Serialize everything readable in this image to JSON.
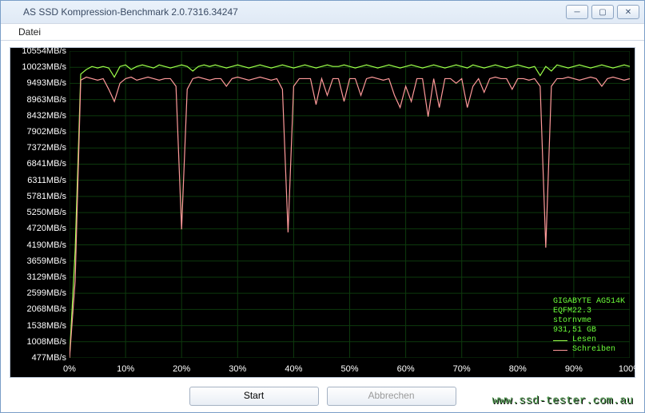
{
  "window": {
    "title": "AS SSD Kompression-Benchmark 2.0.7316.34247"
  },
  "menu": {
    "file": "Datei"
  },
  "legend": {
    "device": "GIGABYTE AG514K",
    "firmware": "EQFM22.3",
    "driver": "stornvme",
    "capacity": "931,51 GB",
    "read": "Lesen",
    "write": "Schreiben"
  },
  "buttons": {
    "start": "Start",
    "abort": "Abbrechen"
  },
  "watermark": "www.ssd-tester.com.au",
  "chart_data": {
    "type": "line",
    "xlabel": "",
    "ylabel": "",
    "xlim": [
      0,
      100
    ],
    "ylim": [
      477,
      10554
    ],
    "y_ticks": [
      477,
      1008,
      1538,
      2068,
      2599,
      3129,
      3659,
      4190,
      4720,
      5250,
      5781,
      6311,
      6841,
      7372,
      7902,
      8432,
      8963,
      9493,
      10023,
      10554
    ],
    "y_tick_suffix": "MB/s",
    "x_ticks": [
      0,
      10,
      20,
      30,
      40,
      50,
      60,
      70,
      80,
      90,
      100
    ],
    "x_tick_suffix": "%",
    "x": [
      0,
      1,
      2,
      3,
      4,
      5,
      6,
      7,
      8,
      9,
      10,
      11,
      12,
      13,
      14,
      15,
      16,
      17,
      18,
      19,
      20,
      21,
      22,
      23,
      24,
      25,
      26,
      27,
      28,
      29,
      30,
      31,
      32,
      33,
      34,
      35,
      36,
      37,
      38,
      39,
      40,
      41,
      42,
      43,
      44,
      45,
      46,
      47,
      48,
      49,
      50,
      51,
      52,
      53,
      54,
      55,
      56,
      57,
      58,
      59,
      60,
      61,
      62,
      63,
      64,
      65,
      66,
      67,
      68,
      69,
      70,
      71,
      72,
      73,
      74,
      75,
      76,
      77,
      78,
      79,
      80,
      81,
      82,
      83,
      84,
      85,
      86,
      87,
      88,
      89,
      90,
      91,
      92,
      93,
      94,
      95,
      96,
      97,
      98,
      99,
      100
    ],
    "series": [
      {
        "name": "Lesen",
        "color": "#9dff4a",
        "values": [
          477,
          4000,
          9800,
          9950,
          10050,
          10000,
          10050,
          10000,
          9700,
          10050,
          10100,
          9950,
          10050,
          10100,
          10050,
          10000,
          10100,
          10050,
          10000,
          10050,
          10100,
          10050,
          9900,
          10050,
          10100,
          10050,
          10100,
          10050,
          10000,
          10050,
          10100,
          10050,
          10000,
          10050,
          10100,
          10050,
          10000,
          10050,
          10100,
          10050,
          10000,
          10050,
          10100,
          10050,
          10000,
          10050,
          10100,
          10050,
          10050,
          10100,
          10050,
          10000,
          10050,
          10100,
          10050,
          10000,
          10050,
          10100,
          10050,
          10000,
          10050,
          10100,
          10050,
          10000,
          10050,
          10100,
          10050,
          10000,
          10050,
          10100,
          10050,
          10000,
          10100,
          10050,
          10000,
          10050,
          10100,
          10050,
          10000,
          10050,
          10100,
          10050,
          10000,
          10050,
          9750,
          10050,
          9900,
          10100,
          10050,
          10000,
          10050,
          10100,
          10050,
          10000,
          10050,
          10100,
          10050,
          10000,
          10050,
          10100,
          10050
        ]
      },
      {
        "name": "Schreiben",
        "color": "#ff9a9a",
        "values": [
          477,
          3000,
          9600,
          9700,
          9650,
          9600,
          9650,
          9300,
          8900,
          9500,
          9650,
          9700,
          9600,
          9650,
          9700,
          9650,
          9600,
          9650,
          9650,
          9400,
          4700,
          9300,
          9650,
          9700,
          9650,
          9600,
          9650,
          9650,
          9400,
          9650,
          9700,
          9650,
          9600,
          9650,
          9700,
          9650,
          9600,
          9650,
          9300,
          4600,
          9400,
          9650,
          9650,
          9650,
          8800,
          9650,
          9100,
          9650,
          9650,
          8900,
          9650,
          9650,
          9100,
          9650,
          9700,
          9650,
          9600,
          9650,
          9100,
          8700,
          9400,
          8900,
          9650,
          9650,
          8400,
          9650,
          8700,
          9650,
          9650,
          9500,
          9650,
          8700,
          9400,
          9650,
          9200,
          9650,
          9700,
          9650,
          9650,
          9300,
          9650,
          9650,
          9600,
          9650,
          9400,
          4100,
          9400,
          9650,
          9650,
          9700,
          9650,
          9600,
          9650,
          9700,
          9650,
          9400,
          9650,
          9700,
          9650,
          9600,
          9650
        ]
      }
    ]
  }
}
